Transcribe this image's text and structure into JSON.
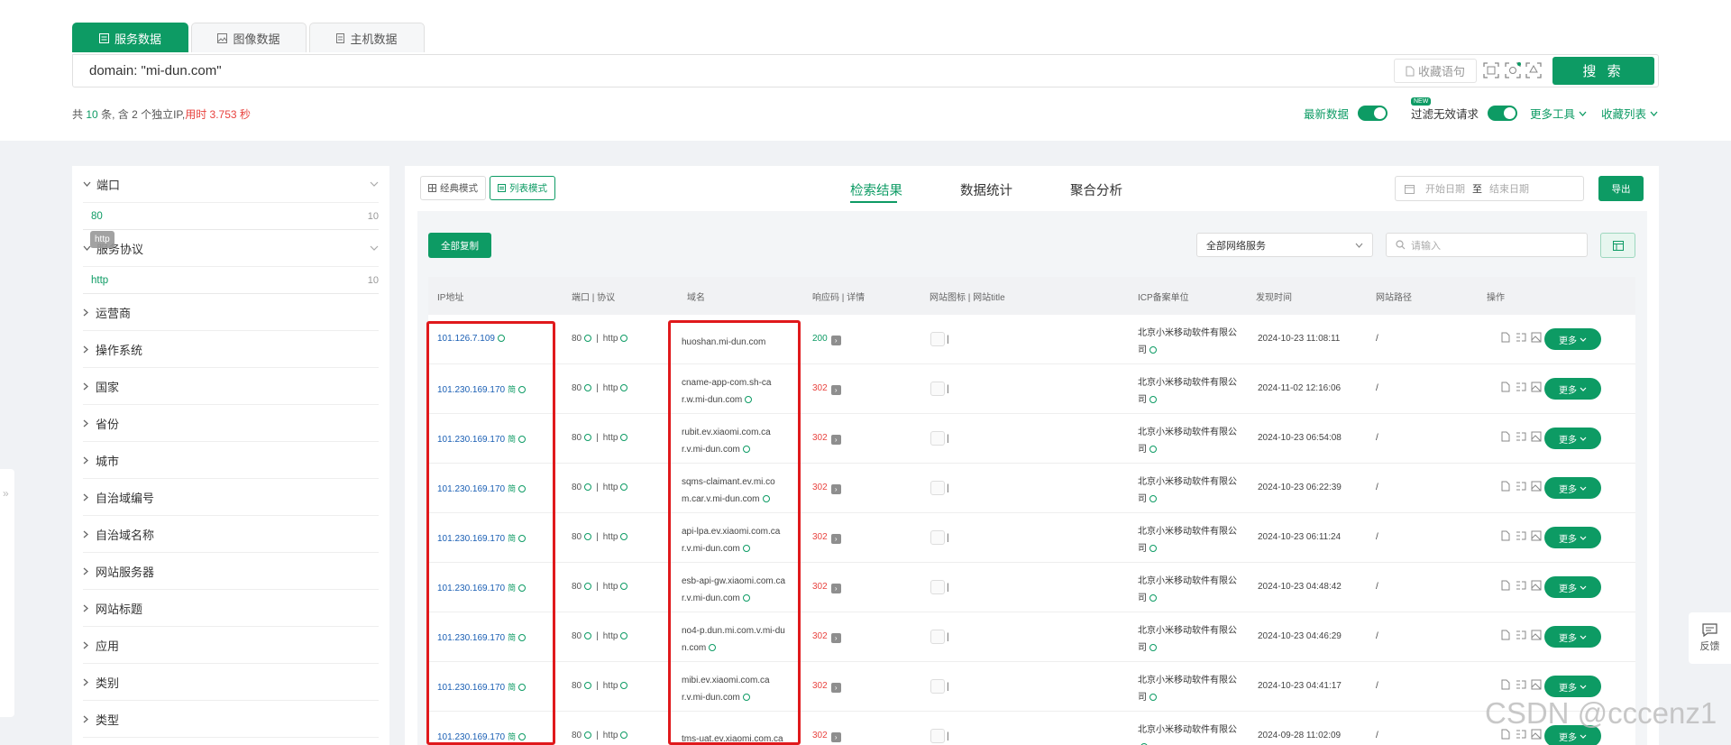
{
  "tabs": [
    {
      "label": "服务数据",
      "icon": "list-icon"
    },
    {
      "label": "图像数据",
      "icon": "image-icon"
    },
    {
      "label": "主机数据",
      "icon": "server-icon"
    }
  ],
  "query": "domain: \"mi-dun.com\"",
  "toolbar": {
    "favorite_label": "收藏语句",
    "search_label": "搜 索"
  },
  "summary": {
    "prefix": "共",
    "count": "10",
    "mid": "条, 含 2 个独立IP,",
    "time": "用时 3.753 秒"
  },
  "top_options": {
    "latest": "最新数据",
    "new_badge": "NEW",
    "filter": "过滤无效请求",
    "more_tools": "更多工具",
    "fav_list": "收藏列表"
  },
  "filters": {
    "port": {
      "title": "端口",
      "value": "80",
      "count": "10"
    },
    "protocol": {
      "title": "服务协议",
      "value": "http",
      "count": "10",
      "tooltip": "http"
    },
    "items": [
      "运营商",
      "操作系统",
      "国家",
      "省份",
      "城市",
      "自治域编号",
      "自治域名称",
      "网站服务器",
      "网站标题",
      "应用",
      "类别",
      "类型"
    ]
  },
  "view_modes": {
    "classic": "经典模式",
    "list": "列表模式"
  },
  "nav_tabs": [
    "检索结果",
    "数据统计",
    "聚合分析"
  ],
  "date": {
    "start": "开始日期",
    "sep": "至",
    "end": "结束日期"
  },
  "export_label": "导出",
  "copy_all_label": "全部复制",
  "service_select": "全部网络服务",
  "search_placeholder": "请输入",
  "columns": [
    "IP地址",
    "端口 | 协议",
    "域名",
    "响应码 | 详情",
    "网站图标 | 网站title",
    "ICP备案单位",
    "发现时间",
    "网站路径",
    "操作"
  ],
  "rows": [
    {
      "ip": "101.126.7.109",
      "flag": "",
      "port": "80",
      "proto": "http",
      "domain1": "huoshan.mi-dun.com",
      "domain2": "",
      "code": "200",
      "icp1": "北京小米移动软件有限公",
      "icp2": "司",
      "time": "2024-10-23 11:08:11",
      "path": "/",
      "op": "更多"
    },
    {
      "ip": "101.230.169.170",
      "flag": "简",
      "port": "80",
      "proto": "http",
      "domain1": "cname-app-com.sh-ca",
      "domain2": "r.w.mi-dun.com",
      "code": "302",
      "icp1": "北京小米移动软件有限公",
      "icp2": "司",
      "time": "2024-11-02 12:16:06",
      "path": "/",
      "op": "更多"
    },
    {
      "ip": "101.230.169.170",
      "flag": "简",
      "port": "80",
      "proto": "http",
      "domain1": "rubit.ev.xiaomi.com.ca",
      "domain2": "r.v.mi-dun.com",
      "code": "302",
      "icp1": "北京小米移动软件有限公",
      "icp2": "司",
      "time": "2024-10-23 06:54:08",
      "path": "/",
      "op": "更多"
    },
    {
      "ip": "101.230.169.170",
      "flag": "简",
      "port": "80",
      "proto": "http",
      "domain1": "sqms-claimant.ev.mi.co",
      "domain2": "m.car.v.mi-dun.com",
      "code": "302",
      "icp1": "北京小米移动软件有限公",
      "icp2": "司",
      "time": "2024-10-23 06:22:39",
      "path": "/",
      "op": "更多"
    },
    {
      "ip": "101.230.169.170",
      "flag": "简",
      "port": "80",
      "proto": "http",
      "domain1": "api-lpa.ev.xiaomi.com.ca",
      "domain2": "r.v.mi-dun.com",
      "code": "302",
      "icp1": "北京小米移动软件有限公",
      "icp2": "司",
      "time": "2024-10-23 06:11:24",
      "path": "/",
      "op": "更多"
    },
    {
      "ip": "101.230.169.170",
      "flag": "简",
      "port": "80",
      "proto": "http",
      "domain1": "esb-api-gw.xiaomi.com.ca",
      "domain2": "r.v.mi-dun.com",
      "code": "302",
      "icp1": "北京小米移动软件有限公",
      "icp2": "司",
      "time": "2024-10-23 04:48:42",
      "path": "/",
      "op": "更多"
    },
    {
      "ip": "101.230.169.170",
      "flag": "简",
      "port": "80",
      "proto": "http",
      "domain1": "no4-p.dun.mi.com.v.mi-du",
      "domain2": "n.com",
      "code": "302",
      "icp1": "北京小米移动软件有限公",
      "icp2": "司",
      "time": "2024-10-23 04:46:29",
      "path": "/",
      "op": "更多"
    },
    {
      "ip": "101.230.169.170",
      "flag": "简",
      "port": "80",
      "proto": "http",
      "domain1": "mibi.ev.xiaomi.com.ca",
      "domain2": "r.v.mi-dun.com",
      "code": "302",
      "icp1": "北京小米移动软件有限公",
      "icp2": "司",
      "time": "2024-10-23 04:41:17",
      "path": "/",
      "op": "更多"
    },
    {
      "ip": "101.230.169.170",
      "flag": "简",
      "port": "80",
      "proto": "http",
      "domain1": "tms-uat.ev.xiaomi.com.ca",
      "domain2": "",
      "code": "302",
      "icp1": "北京小米移动软件有限公",
      "icp2": "",
      "time": "2024-09-28 11:02:09",
      "path": "/",
      "op": "更多"
    }
  ],
  "feedback_label": "反馈",
  "watermark": "CSDN @cccenz1",
  "colors": {
    "accent": "#0d9b64",
    "error": "#e8433f",
    "ip": "#1a5fb4",
    "highlight": "#e0191c"
  }
}
